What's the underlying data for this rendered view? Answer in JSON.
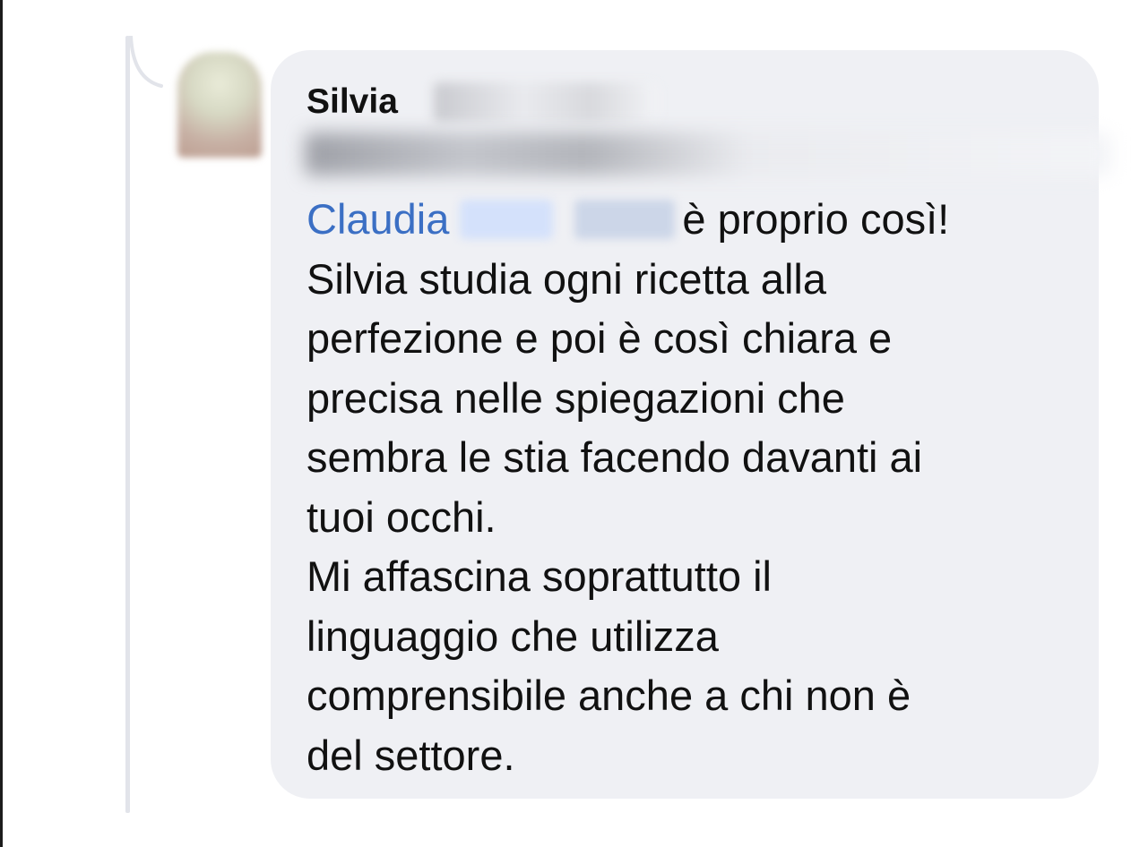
{
  "comment": {
    "author_first_name": "Silvia",
    "mention_name": "Claudia",
    "message_lines": [
      "è proprio così!",
      "Silvia studia ogni ricetta alla",
      "perfezione e poi è così chiara e",
      "precisa nelle spiegazioni che",
      "sembra le stia facendo davanti ai",
      "tuoi occhi.",
      "Mi affascina soprattutto il",
      "linguaggio che utilizza",
      "comprensibile anche a chi non è",
      "del settore."
    ]
  },
  "colors": {
    "bubble": "#eff0f4",
    "mention": "#3b6fc4",
    "text": "#111111",
    "thread_line": "#e2e4ea"
  }
}
